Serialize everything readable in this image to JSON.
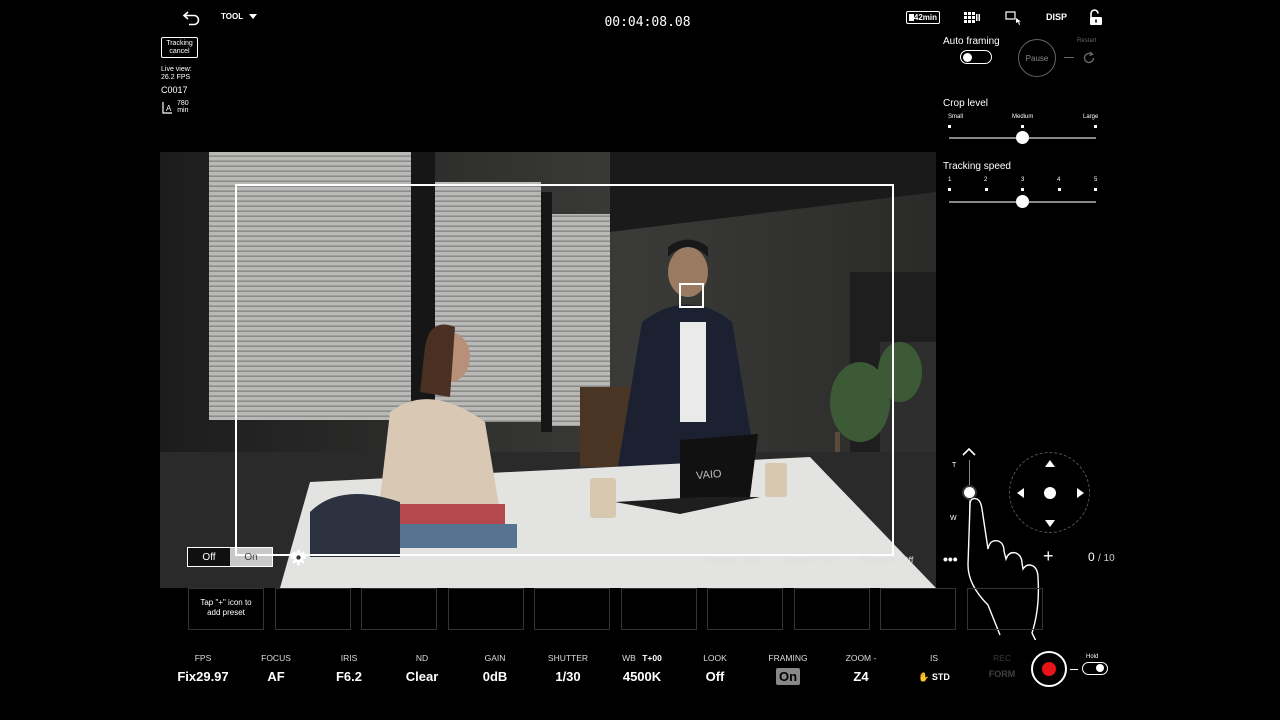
{
  "header": {
    "tool_label": "TOOL",
    "timecode": "00:04:08.08",
    "battery": "42min",
    "disp_label": "DISP"
  },
  "left_info": {
    "tracking_cancel": [
      "Tracking",
      "cancel"
    ],
    "live_view_label": "Live view:",
    "live_view_fps": "26.2 FPS",
    "clip_name": "C0017",
    "media_remaining_value": "780",
    "media_remaining_unit": "min"
  },
  "right_panel": {
    "auto_framing_label": "Auto framing",
    "auto_framing_on": false,
    "pause_label": "Pause",
    "restart_label": "Restart",
    "crop_level": {
      "label": "Crop level",
      "ticks": [
        "Small",
        "Medium",
        "Large"
      ],
      "value": "Medium"
    },
    "tracking_speed": {
      "label": "Tracking speed",
      "ticks": [
        "1",
        "2",
        "3",
        "4",
        "5"
      ],
      "value": "3"
    }
  },
  "video_overlay": {
    "framing_off": "Off",
    "framing_on": "On",
    "interval": "Interval : 10s",
    "smooth": "Smooth : Off",
    "random": "Random : Off"
  },
  "zoom": {
    "t_label": "T",
    "w_label": "W"
  },
  "presets": {
    "hint": [
      "Tap \"+\" icon to",
      "add preset"
    ],
    "count": "0",
    "total": "/ 10",
    "more": "•••",
    "add": "+"
  },
  "params": [
    {
      "label": "FPS",
      "value": "Fix29.97"
    },
    {
      "label": "FOCUS",
      "value": "AF"
    },
    {
      "label": "IRIS",
      "value": "F6.2"
    },
    {
      "label": "ND",
      "value": "Clear"
    },
    {
      "label": "GAIN",
      "value": "0dB"
    },
    {
      "label": "SHUTTER",
      "value": "1/30"
    },
    {
      "label": "WB",
      "label2": "T+00",
      "value": "4500K"
    },
    {
      "label": "LOOK",
      "value": "Off"
    },
    {
      "label": "FRAMING",
      "value": "On"
    },
    {
      "label": "ZOOM",
      "value": "Z4"
    },
    {
      "label": "IS",
      "value": "STD"
    },
    {
      "label": "REC",
      "value": "FORM"
    }
  ],
  "record": {
    "hold_label": "Hold"
  },
  "colors": {
    "record": "#e8141a",
    "accent": "#ffffff"
  }
}
